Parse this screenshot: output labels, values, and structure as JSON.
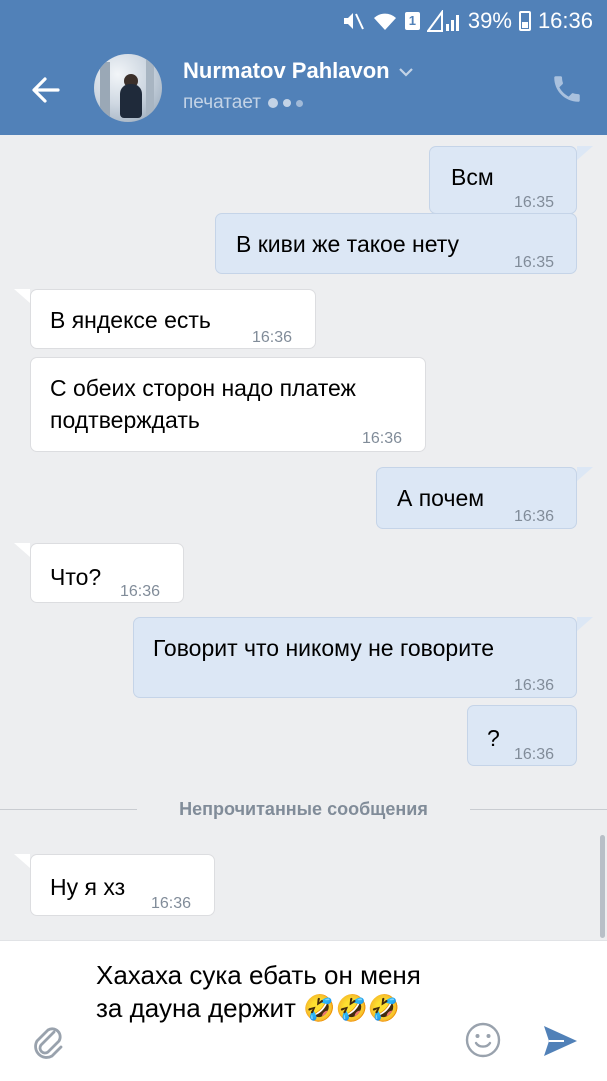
{
  "status_bar": {
    "sim_number": "1",
    "battery_percent": "39%",
    "time": "16:36"
  },
  "header": {
    "contact_name": "Nurmatov Pahlavon",
    "status": "печатает",
    "icons": [
      "back-arrow-icon",
      "chevron-down-icon",
      "phone-icon"
    ]
  },
  "messages": [
    {
      "direction": "out",
      "text": "Всм",
      "time": "16:35"
    },
    {
      "direction": "out",
      "text": "В киви же такое нету",
      "time": "16:35"
    },
    {
      "direction": "in",
      "text": "В яндексе есть",
      "time": "16:36"
    },
    {
      "direction": "in",
      "text": "С обеих сторон надо платеж\nподтверждать",
      "time": "16:36"
    },
    {
      "direction": "out",
      "text": "А почем",
      "time": "16:36"
    },
    {
      "direction": "in",
      "text": "Что?",
      "time": "16:36"
    },
    {
      "direction": "out",
      "text": "Говорит что никому не говорите",
      "time": "16:36"
    },
    {
      "direction": "out",
      "text": "?",
      "time": "16:36"
    },
    {
      "direction": "in",
      "text": "Ну я хз",
      "time": "16:36"
    }
  ],
  "unread_divider": "Непрочитанные сообщения",
  "composer": {
    "text": "Хахаха сука ебать он меня за дауна держит 🤣🤣🤣",
    "icons": [
      "paperclip-icon",
      "smile-icon",
      "send-icon"
    ]
  },
  "colors": {
    "header": "#5181b8",
    "background": "#edeef0",
    "outgoing_bubble": "#dce7f5",
    "incoming_bubble": "#ffffff",
    "accent": "#5181b8"
  }
}
